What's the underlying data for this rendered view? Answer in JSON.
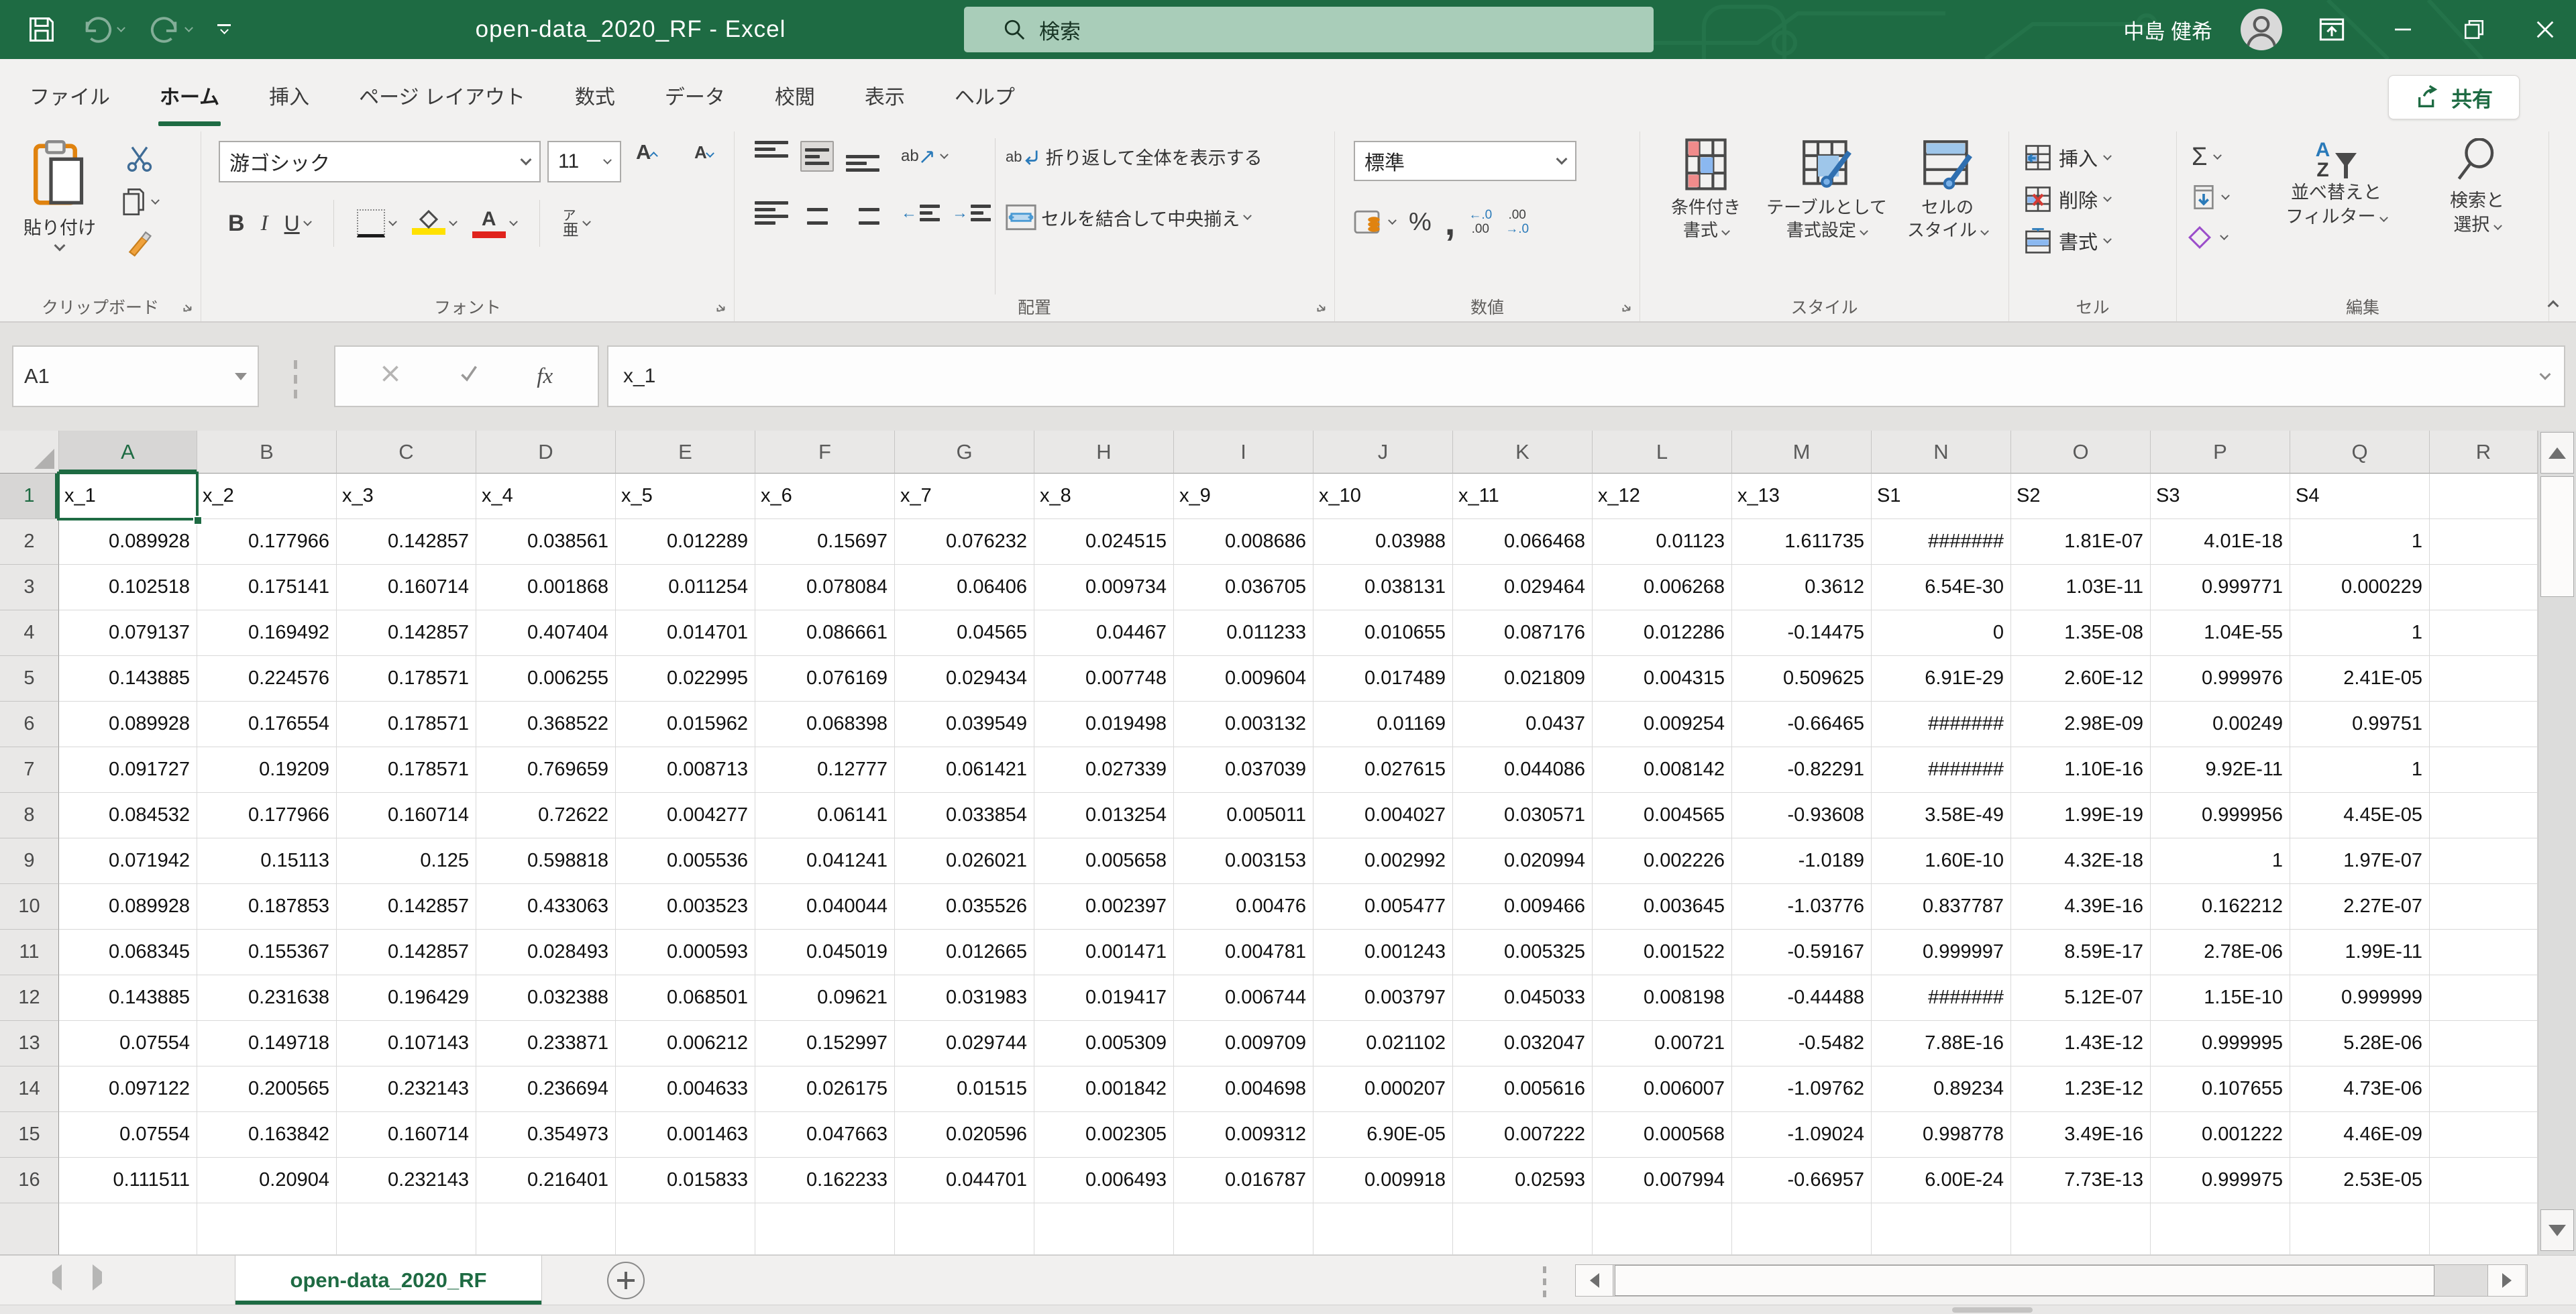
{
  "colors": {
    "accent": "#1e6b43",
    "titlebar_bg": "#1e6b43",
    "search_bg": "#a9cdb9",
    "fill_yellow": "#ffe100",
    "font_red": "#e0231c",
    "clear_purple": "#9b4dca",
    "icon_blue": "#2a7ab9"
  },
  "titlebar": {
    "title": "open-data_2020_RF - Excel",
    "search_label": "検索",
    "user_name": "中島 健希"
  },
  "tabs": {
    "share_label": "共有",
    "items": [
      {
        "label": "ファイル"
      },
      {
        "label": "ホーム"
      },
      {
        "label": "挿入"
      },
      {
        "label": "ページ レイアウト"
      },
      {
        "label": "数式"
      },
      {
        "label": "データ"
      },
      {
        "label": "校閲"
      },
      {
        "label": "表示"
      },
      {
        "label": "ヘルプ"
      }
    ],
    "active": "ホーム"
  },
  "ribbon": {
    "clipboard": {
      "group_label": "クリップボード",
      "paste_label": "貼り付け"
    },
    "font": {
      "group_label": "フォント",
      "font_name": "游ゴシック",
      "font_size": "11",
      "bold": "B",
      "italic": "I",
      "underline": "U",
      "grow": "A",
      "shrink": "A",
      "phonetic_top": "ア",
      "phonetic_bottom": "亜"
    },
    "alignment": {
      "group_label": "配置",
      "orientation_text": "ab",
      "wrap_icon_text": "ab",
      "wrap_label": "折り返して全体を表示する",
      "merge_label": "セルを結合して中央揃え"
    },
    "number": {
      "group_label": "数値",
      "format_value": "標準",
      "percent_icon": "%",
      "comma_icon": ",",
      "inc_top": "←.0",
      "inc_bot": ".00",
      "dec_top": ".00",
      "dec_bot": "→.0"
    },
    "styles": {
      "group_label": "スタイル",
      "conditional": [
        "条件付き",
        "書式"
      ],
      "table": [
        "テーブルとして",
        "書式設定"
      ],
      "cell_styles": [
        "セルの",
        "スタイル"
      ]
    },
    "cells": {
      "group_label": "セル",
      "insert_label": "挿入",
      "delete_label": "削除",
      "format_label": "書式"
    },
    "editing": {
      "group_label": "編集",
      "autosum": "Σ",
      "sort_letter_a": "A",
      "sort_letter_z": "Z",
      "sort": [
        "並べ替えと",
        "フィルター"
      ],
      "find": [
        "検索と",
        "選択"
      ]
    }
  },
  "formula_bar": {
    "name_box_value": "A1",
    "fx_label": "fx",
    "content": "x_1"
  },
  "grid": {
    "columns": [
      "A",
      "B",
      "C",
      "D",
      "E",
      "F",
      "G",
      "H",
      "I",
      "J",
      "K",
      "L",
      "M",
      "N",
      "O",
      "P",
      "Q",
      "R"
    ],
    "selected_cell": "A1",
    "rows": [
      {
        "n": "1",
        "cells": [
          "x_1",
          "x_2",
          "x_3",
          "x_4",
          "x_5",
          "x_6",
          "x_7",
          "x_8",
          "x_9",
          "x_10",
          "x_11",
          "x_12",
          "x_13",
          "S1",
          "S2",
          "S3",
          "S4"
        ]
      },
      {
        "n": "2",
        "cells": [
          "0.089928",
          "0.177966",
          "0.142857",
          "0.038561",
          "0.012289",
          "0.15697",
          "0.076232",
          "0.024515",
          "0.008686",
          "0.03988",
          "0.066468",
          "0.01123",
          "1.611735",
          "#######",
          "1.81E-07",
          "4.01E-18",
          "1"
        ]
      },
      {
        "n": "3",
        "cells": [
          "0.102518",
          "0.175141",
          "0.160714",
          "0.001868",
          "0.011254",
          "0.078084",
          "0.06406",
          "0.009734",
          "0.036705",
          "0.038131",
          "0.029464",
          "0.006268",
          "0.3612",
          "6.54E-30",
          "1.03E-11",
          "0.999771",
          "0.000229"
        ]
      },
      {
        "n": "4",
        "cells": [
          "0.079137",
          "0.169492",
          "0.142857",
          "0.407404",
          "0.014701",
          "0.086661",
          "0.04565",
          "0.04467",
          "0.011233",
          "0.010655",
          "0.087176",
          "0.012286",
          "-0.14475",
          "0",
          "1.35E-08",
          "1.04E-55",
          "1"
        ]
      },
      {
        "n": "5",
        "cells": [
          "0.143885",
          "0.224576",
          "0.178571",
          "0.006255",
          "0.022995",
          "0.076169",
          "0.029434",
          "0.007748",
          "0.009604",
          "0.017489",
          "0.021809",
          "0.004315",
          "0.509625",
          "6.91E-29",
          "2.60E-12",
          "0.999976",
          "2.41E-05"
        ]
      },
      {
        "n": "6",
        "cells": [
          "0.089928",
          "0.176554",
          "0.178571",
          "0.368522",
          "0.015962",
          "0.068398",
          "0.039549",
          "0.019498",
          "0.003132",
          "0.01169",
          "0.0437",
          "0.009254",
          "-0.66465",
          "#######",
          "2.98E-09",
          "0.00249",
          "0.99751"
        ]
      },
      {
        "n": "7",
        "cells": [
          "0.091727",
          "0.19209",
          "0.178571",
          "0.769659",
          "0.008713",
          "0.12777",
          "0.061421",
          "0.027339",
          "0.037039",
          "0.027615",
          "0.044086",
          "0.008142",
          "-0.82291",
          "#######",
          "1.10E-16",
          "9.92E-11",
          "1"
        ]
      },
      {
        "n": "8",
        "cells": [
          "0.084532",
          "0.177966",
          "0.160714",
          "0.72622",
          "0.004277",
          "0.06141",
          "0.033854",
          "0.013254",
          "0.005011",
          "0.004027",
          "0.030571",
          "0.004565",
          "-0.93608",
          "3.58E-49",
          "1.99E-19",
          "0.999956",
          "4.45E-05"
        ]
      },
      {
        "n": "9",
        "cells": [
          "0.071942",
          "0.15113",
          "0.125",
          "0.598818",
          "0.005536",
          "0.041241",
          "0.026021",
          "0.005658",
          "0.003153",
          "0.002992",
          "0.020994",
          "0.002226",
          "-1.0189",
          "1.60E-10",
          "4.32E-18",
          "1",
          "1.97E-07"
        ]
      },
      {
        "n": "10",
        "cells": [
          "0.089928",
          "0.187853",
          "0.142857",
          "0.433063",
          "0.003523",
          "0.040044",
          "0.035526",
          "0.002397",
          "0.00476",
          "0.005477",
          "0.009466",
          "0.003645",
          "-1.03776",
          "0.837787",
          "4.39E-16",
          "0.162212",
          "2.27E-07"
        ]
      },
      {
        "n": "11",
        "cells": [
          "0.068345",
          "0.155367",
          "0.142857",
          "0.028493",
          "0.000593",
          "0.045019",
          "0.012665",
          "0.001471",
          "0.004781",
          "0.001243",
          "0.005325",
          "0.001522",
          "-0.59167",
          "0.999997",
          "8.59E-17",
          "2.78E-06",
          "1.99E-11"
        ]
      },
      {
        "n": "12",
        "cells": [
          "0.143885",
          "0.231638",
          "0.196429",
          "0.032388",
          "0.068501",
          "0.09621",
          "0.031983",
          "0.019417",
          "0.006744",
          "0.003797",
          "0.045033",
          "0.008198",
          "-0.44488",
          "#######",
          "5.12E-07",
          "1.15E-10",
          "0.999999"
        ]
      },
      {
        "n": "13",
        "cells": [
          "0.07554",
          "0.149718",
          "0.107143",
          "0.233871",
          "0.006212",
          "0.152997",
          "0.029744",
          "0.005309",
          "0.009709",
          "0.021102",
          "0.032047",
          "0.00721",
          "-0.5482",
          "7.88E-16",
          "1.43E-12",
          "0.999995",
          "5.28E-06"
        ]
      },
      {
        "n": "14",
        "cells": [
          "0.097122",
          "0.200565",
          "0.232143",
          "0.236694",
          "0.004633",
          "0.026175",
          "0.01515",
          "0.001842",
          "0.004698",
          "0.000207",
          "0.005616",
          "0.006007",
          "-1.09762",
          "0.89234",
          "1.23E-12",
          "0.107655",
          "4.73E-06"
        ]
      },
      {
        "n": "15",
        "cells": [
          "0.07554",
          "0.163842",
          "0.160714",
          "0.354973",
          "0.001463",
          "0.047663",
          "0.020596",
          "0.002305",
          "0.009312",
          "6.90E-05",
          "0.007222",
          "0.000568",
          "-1.09024",
          "0.998778",
          "3.49E-16",
          "0.001222",
          "4.46E-09"
        ]
      },
      {
        "n": "16",
        "cells": [
          "0.111511",
          "0.20904",
          "0.232143",
          "0.216401",
          "0.015833",
          "0.162233",
          "0.044701",
          "0.006493",
          "0.016787",
          "0.009918",
          "0.02593",
          "0.007994",
          "-0.66957",
          "6.00E-24",
          "7.73E-13",
          "0.999975",
          "2.53E-05"
        ]
      }
    ]
  },
  "sheet_bar": {
    "tab_label": "open-data_2020_RF"
  }
}
